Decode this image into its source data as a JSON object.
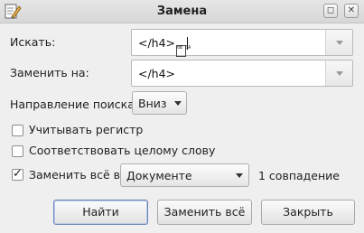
{
  "window": {
    "title": "Замена",
    "buttons": {
      "restore_icon": "restore-icon",
      "close_icon": "close-icon"
    }
  },
  "search": {
    "label": "Искать:",
    "value": "</h4>",
    "trailing_glyph": "0B 0A"
  },
  "replace": {
    "label": "Заменить на:",
    "value": "</h4>"
  },
  "direction": {
    "label": "Направление поиска:",
    "value": "Вниз"
  },
  "options": {
    "match_case": {
      "label": "Учитывать регистр",
      "checked": false
    },
    "whole_word": {
      "label": "Соответствовать целому слову",
      "checked": false
    },
    "replace_all_in": {
      "label": "Заменить всё в:",
      "checked": true
    }
  },
  "scope": {
    "value": "Документе"
  },
  "match_count": "1 совпадение",
  "actions": {
    "find": "Найти",
    "replace_all": "Заменить всё",
    "close": "Закрыть"
  },
  "colors": {
    "default_button_border": "#6a86b8",
    "background": "#efefef"
  }
}
